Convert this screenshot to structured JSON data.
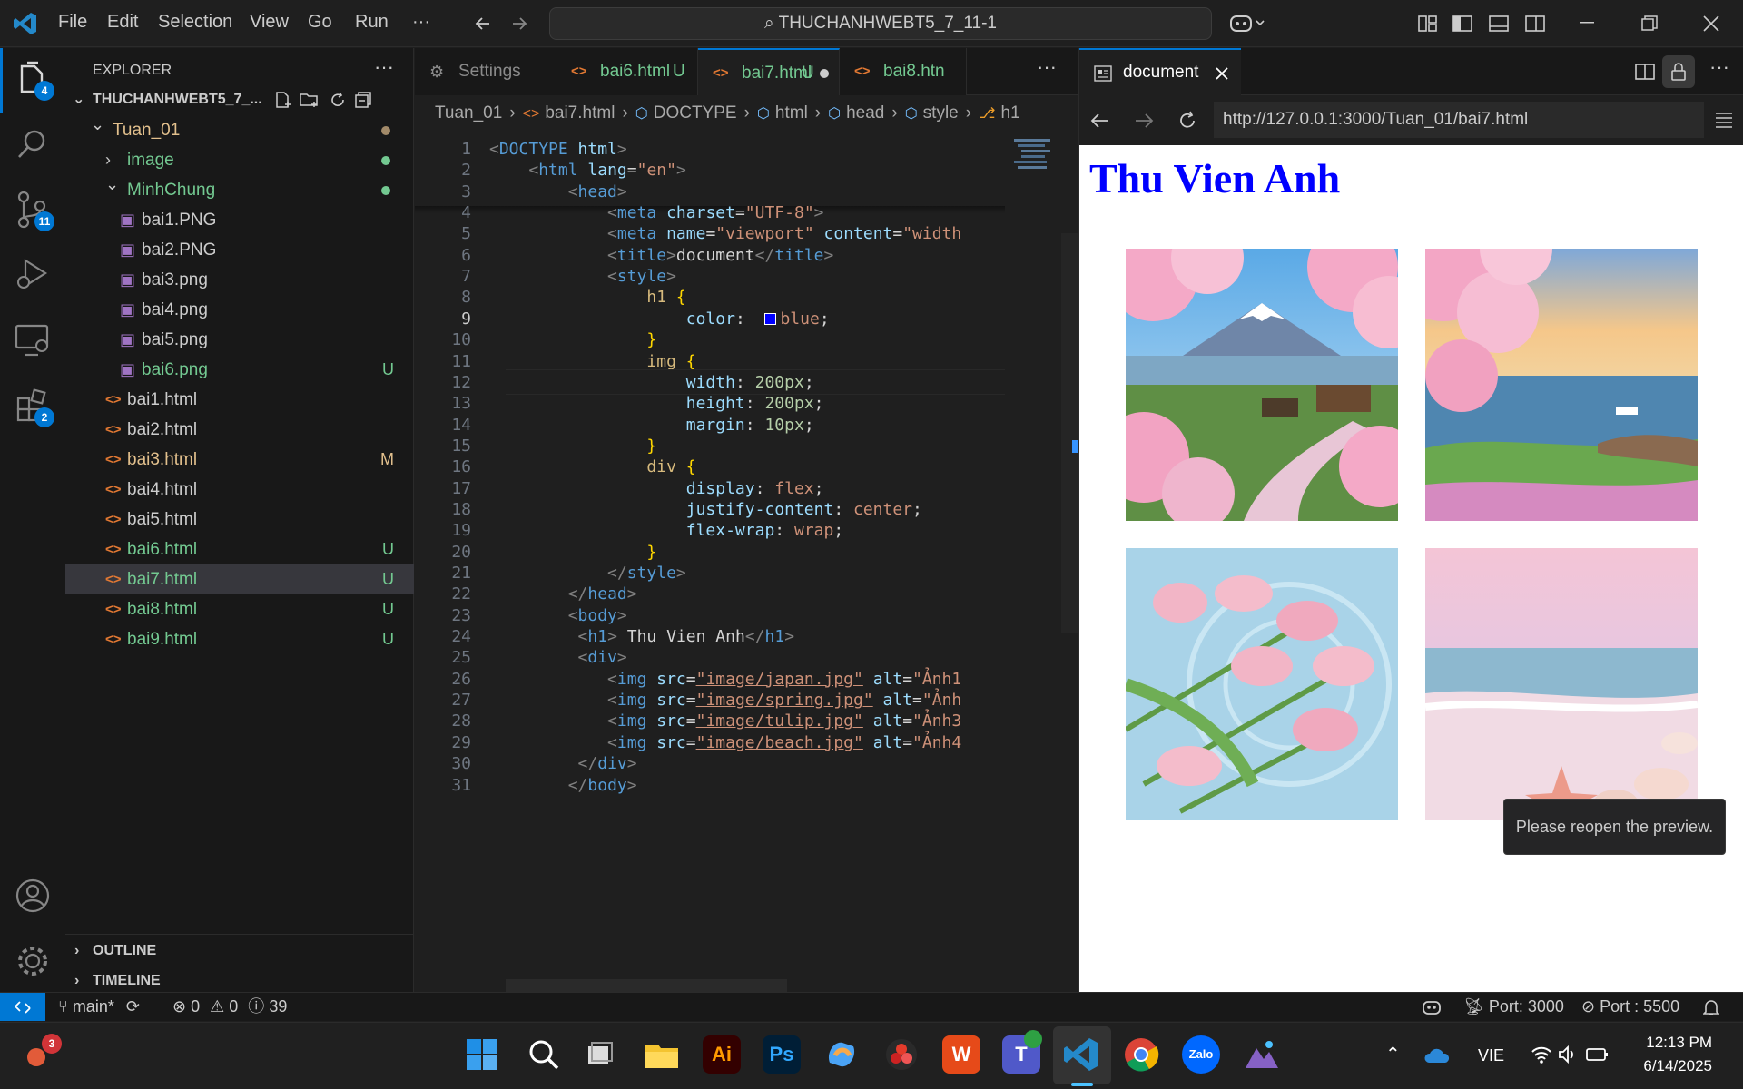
{
  "titlebar": {
    "menu": [
      "File",
      "Edit",
      "Selection",
      "View",
      "Go",
      "Run",
      "···"
    ],
    "search": "THUCHANHWEBT5_7_11-1"
  },
  "activity": {
    "explorer_badge": "4",
    "scm_badge": "11",
    "extensions_badge": "2"
  },
  "explorer": {
    "title": "EXPLORER",
    "root": "THUCHANHWEBT5_7_...",
    "items": [
      {
        "label": "Tuan_01",
        "indent": 1,
        "type": "folder-open",
        "color": "#e2c08d",
        "git": "dot",
        "gitcolor": "#a28a69"
      },
      {
        "label": "image",
        "indent": 2,
        "type": "folder",
        "color": "#73c991",
        "git": "dot",
        "gitcolor": "#73c991"
      },
      {
        "label": "MinhChung",
        "indent": 2,
        "type": "folder-open",
        "color": "#73c991",
        "git": "dot",
        "gitcolor": "#73c991"
      },
      {
        "label": "bai1.PNG",
        "indent": 3,
        "type": "image",
        "color": "#cccccc",
        "git": ""
      },
      {
        "label": "bai2.PNG",
        "indent": 3,
        "type": "image",
        "color": "#cccccc",
        "git": ""
      },
      {
        "label": "bai3.png",
        "indent": 3,
        "type": "image",
        "color": "#cccccc",
        "git": ""
      },
      {
        "label": "bai4.png",
        "indent": 3,
        "type": "image",
        "color": "#cccccc",
        "git": ""
      },
      {
        "label": "bai5.png",
        "indent": 3,
        "type": "image",
        "color": "#cccccc",
        "git": ""
      },
      {
        "label": "bai6.png",
        "indent": 3,
        "type": "image",
        "color": "#73c991",
        "git": "U",
        "gitcolor": "#73c991"
      },
      {
        "label": "bai1.html",
        "indent": 2,
        "type": "html",
        "color": "#cccccc",
        "git": ""
      },
      {
        "label": "bai2.html",
        "indent": 2,
        "type": "html",
        "color": "#cccccc",
        "git": ""
      },
      {
        "label": "bai3.html",
        "indent": 2,
        "type": "html",
        "color": "#e2c08d",
        "git": "M",
        "gitcolor": "#e2c08d"
      },
      {
        "label": "bai4.html",
        "indent": 2,
        "type": "html",
        "color": "#cccccc",
        "git": ""
      },
      {
        "label": "bai5.html",
        "indent": 2,
        "type": "html",
        "color": "#cccccc",
        "git": ""
      },
      {
        "label": "bai6.html",
        "indent": 2,
        "type": "html",
        "color": "#73c991",
        "git": "U",
        "gitcolor": "#73c991"
      },
      {
        "label": "bai7.html",
        "indent": 2,
        "type": "html",
        "color": "#73c991",
        "git": "U",
        "gitcolor": "#73c991",
        "selected": true
      },
      {
        "label": "bai8.html",
        "indent": 2,
        "type": "html",
        "color": "#73c991",
        "git": "U",
        "gitcolor": "#73c991"
      },
      {
        "label": "bai9.html",
        "indent": 2,
        "type": "html",
        "color": "#73c991",
        "git": "U",
        "gitcolor": "#73c991"
      }
    ],
    "outline": "OUTLINE",
    "timeline": "TIMELINE"
  },
  "editor": {
    "tabs": [
      {
        "label": "Settings",
        "marker": "",
        "color": "#8b8b8b"
      },
      {
        "label": "bai6.html",
        "marker": "U",
        "color": "#73c991"
      },
      {
        "label": "bai7.html",
        "marker": "U",
        "color": "#73c991",
        "active": true
      },
      {
        "label": "bai8.htn",
        "marker": "",
        "color": "#73c991"
      }
    ],
    "breadcrumb": [
      "Tuan_01",
      "bai7.html",
      "DOCTYPE",
      "html",
      "head",
      "style",
      "h1"
    ],
    "lines": [
      {
        "n": "1",
        "segs": [
          [
            "t",
            "<"
          ],
          [
            "tag",
            "DOCTYPE"
          ],
          [
            "txt",
            " "
          ],
          [
            "attr",
            "html"
          ],
          [
            "t",
            ">"
          ]
        ]
      },
      {
        "n": "2",
        "segs": [
          [
            "txt",
            "    "
          ],
          [
            "t",
            "<"
          ],
          [
            "tag",
            "html"
          ],
          [
            "txt",
            " "
          ],
          [
            "attr",
            "lang"
          ],
          [
            "txt",
            "="
          ],
          [
            "str",
            "\"en\""
          ],
          [
            "t",
            ">"
          ]
        ]
      },
      {
        "n": "3",
        "segs": [
          [
            "txt",
            "        "
          ],
          [
            "t",
            "<"
          ],
          [
            "tag",
            "head"
          ],
          [
            "t",
            ">"
          ]
        ]
      },
      {
        "n": "4",
        "segs": [
          [
            "txt",
            "            "
          ],
          [
            "t",
            "<"
          ],
          [
            "tag",
            "meta"
          ],
          [
            "txt",
            " "
          ],
          [
            "attr",
            "charset"
          ],
          [
            "txt",
            "="
          ],
          [
            "str",
            "\"UTF-8\""
          ],
          [
            "t",
            ">"
          ]
        ]
      },
      {
        "n": "5",
        "segs": [
          [
            "txt",
            "            "
          ],
          [
            "t",
            "<"
          ],
          [
            "tag",
            "meta"
          ],
          [
            "txt",
            " "
          ],
          [
            "attr",
            "name"
          ],
          [
            "txt",
            "="
          ],
          [
            "str",
            "\"viewport\""
          ],
          [
            "txt",
            " "
          ],
          [
            "attr",
            "content"
          ],
          [
            "txt",
            "="
          ],
          [
            "str",
            "\"width"
          ]
        ]
      },
      {
        "n": "6",
        "segs": [
          [
            "txt",
            "            "
          ],
          [
            "t",
            "<"
          ],
          [
            "tag",
            "title"
          ],
          [
            "t",
            ">"
          ],
          [
            "txt",
            "document"
          ],
          [
            "t",
            "</"
          ],
          [
            "tag",
            "title"
          ],
          [
            "t",
            ">"
          ]
        ]
      },
      {
        "n": "7",
        "segs": [
          [
            "txt",
            "            "
          ],
          [
            "t",
            "<"
          ],
          [
            "tag",
            "style"
          ],
          [
            "t",
            ">"
          ]
        ]
      },
      {
        "n": "8",
        "segs": [
          [
            "txt",
            "                "
          ],
          [
            "sel1",
            "h1"
          ],
          [
            "txt",
            " "
          ],
          [
            "br",
            "{"
          ]
        ]
      },
      {
        "n": "9",
        "segs": [
          [
            "txt",
            "                    "
          ],
          [
            "prop",
            "color"
          ],
          [
            "txt",
            ":  "
          ],
          [
            "val",
            "blue"
          ],
          [
            "txt",
            ";"
          ]
        ],
        "swatch": true
      },
      {
        "n": "10",
        "segs": [
          [
            "txt",
            "                "
          ],
          [
            "br",
            "}"
          ]
        ]
      },
      {
        "n": "11",
        "segs": [
          [
            "txt",
            "                "
          ],
          [
            "sel1",
            "img"
          ],
          [
            "txt",
            " "
          ],
          [
            "br",
            "{"
          ]
        ]
      },
      {
        "n": "12",
        "segs": [
          [
            "txt",
            "                    "
          ],
          [
            "prop",
            "width"
          ],
          [
            "txt",
            ": "
          ],
          [
            "num",
            "200px"
          ],
          [
            "txt",
            ";"
          ]
        ]
      },
      {
        "n": "13",
        "segs": [
          [
            "txt",
            "                    "
          ],
          [
            "prop",
            "height"
          ],
          [
            "txt",
            ": "
          ],
          [
            "num",
            "200px"
          ],
          [
            "txt",
            ";"
          ]
        ]
      },
      {
        "n": "14",
        "segs": [
          [
            "txt",
            "                    "
          ],
          [
            "prop",
            "margin"
          ],
          [
            "txt",
            ": "
          ],
          [
            "num",
            "10px"
          ],
          [
            "txt",
            ";"
          ]
        ]
      },
      {
        "n": "15",
        "segs": [
          [
            "txt",
            "                "
          ],
          [
            "br",
            "}"
          ]
        ]
      },
      {
        "n": "16",
        "segs": [
          [
            "txt",
            "                "
          ],
          [
            "sel1",
            "div"
          ],
          [
            "txt",
            " "
          ],
          [
            "br",
            "{"
          ]
        ]
      },
      {
        "n": "17",
        "segs": [
          [
            "txt",
            "                    "
          ],
          [
            "prop",
            "display"
          ],
          [
            "txt",
            ": "
          ],
          [
            "val",
            "flex"
          ],
          [
            "txt",
            ";"
          ]
        ]
      },
      {
        "n": "18",
        "segs": [
          [
            "txt",
            "                    "
          ],
          [
            "prop",
            "justify-content"
          ],
          [
            "txt",
            ": "
          ],
          [
            "val",
            "center"
          ],
          [
            "txt",
            ";"
          ]
        ]
      },
      {
        "n": "19",
        "segs": [
          [
            "txt",
            "                    "
          ],
          [
            "prop",
            "flex-wrap"
          ],
          [
            "txt",
            ": "
          ],
          [
            "val",
            "wrap"
          ],
          [
            "txt",
            ";"
          ]
        ]
      },
      {
        "n": "20",
        "segs": [
          [
            "txt",
            "                "
          ],
          [
            "br",
            "}"
          ]
        ]
      },
      {
        "n": "21",
        "segs": [
          [
            "txt",
            "            "
          ],
          [
            "t",
            "</"
          ],
          [
            "tag",
            "style"
          ],
          [
            "t",
            ">"
          ]
        ]
      },
      {
        "n": "22",
        "segs": [
          [
            "txt",
            "        "
          ],
          [
            "t",
            "</"
          ],
          [
            "tag",
            "head"
          ],
          [
            "t",
            ">"
          ]
        ]
      },
      {
        "n": "23",
        "segs": [
          [
            "txt",
            "        "
          ],
          [
            "t",
            "<"
          ],
          [
            "tag",
            "body"
          ],
          [
            "t",
            ">"
          ]
        ]
      },
      {
        "n": "24",
        "segs": [
          [
            "txt",
            "         "
          ],
          [
            "t",
            "<"
          ],
          [
            "tag",
            "h1"
          ],
          [
            "t",
            ">"
          ],
          [
            "txt",
            " Thu Vien Anh"
          ],
          [
            "t",
            "</"
          ],
          [
            "tag",
            "h1"
          ],
          [
            "t",
            ">"
          ]
        ]
      },
      {
        "n": "25",
        "segs": [
          [
            "txt",
            "         "
          ],
          [
            "t",
            "<"
          ],
          [
            "tag",
            "div"
          ],
          [
            "t",
            ">"
          ]
        ]
      },
      {
        "n": "26",
        "segs": [
          [
            "txt",
            "            "
          ],
          [
            "t",
            "<"
          ],
          [
            "tag",
            "img"
          ],
          [
            "txt",
            " "
          ],
          [
            "attr",
            "src"
          ],
          [
            "txt",
            "="
          ],
          [
            "str",
            "\"image/japan.jpg\""
          ],
          [
            "txt",
            " "
          ],
          [
            "attr",
            "alt"
          ],
          [
            "txt",
            "="
          ],
          [
            "str",
            "\"Ảnh1"
          ]
        ]
      },
      {
        "n": "27",
        "segs": [
          [
            "txt",
            "            "
          ],
          [
            "t",
            "<"
          ],
          [
            "tag",
            "img"
          ],
          [
            "txt",
            " "
          ],
          [
            "attr",
            "src"
          ],
          [
            "txt",
            "="
          ],
          [
            "str",
            "\"image/spring.jpg\""
          ],
          [
            "txt",
            " "
          ],
          [
            "attr",
            "alt"
          ],
          [
            "txt",
            "="
          ],
          [
            "str",
            "\"Ảnh"
          ]
        ]
      },
      {
        "n": "28",
        "segs": [
          [
            "txt",
            "            "
          ],
          [
            "t",
            "<"
          ],
          [
            "tag",
            "img"
          ],
          [
            "txt",
            " "
          ],
          [
            "attr",
            "src"
          ],
          [
            "txt",
            "="
          ],
          [
            "str",
            "\"image/tulip.jpg\""
          ],
          [
            "txt",
            " "
          ],
          [
            "attr",
            "alt"
          ],
          [
            "txt",
            "="
          ],
          [
            "str",
            "\"Ảnh3"
          ]
        ]
      },
      {
        "n": "29",
        "segs": [
          [
            "txt",
            "            "
          ],
          [
            "t",
            "<"
          ],
          [
            "tag",
            "img"
          ],
          [
            "txt",
            " "
          ],
          [
            "attr",
            "src"
          ],
          [
            "txt",
            "="
          ],
          [
            "str",
            "\"image/beach.jpg\""
          ],
          [
            "txt",
            " "
          ],
          [
            "attr",
            "alt"
          ],
          [
            "txt",
            "="
          ],
          [
            "str",
            "\"Ảnh4"
          ]
        ]
      },
      {
        "n": "30",
        "segs": [
          [
            "txt",
            "         "
          ],
          [
            "t",
            "</"
          ],
          [
            "tag",
            "div"
          ],
          [
            "t",
            ">"
          ]
        ]
      },
      {
        "n": "31",
        "segs": [
          [
            "txt",
            "        "
          ],
          [
            "t",
            "</"
          ],
          [
            "tag",
            "body"
          ],
          [
            "t",
            ">"
          ]
        ]
      }
    ]
  },
  "preview": {
    "tab": "document",
    "url": "http://127.0.0.1:3000/Tuan_01/bai7.html",
    "heading": "Thu Vien Anh",
    "toast": "Please reopen the preview."
  },
  "statusbar": {
    "branch": "main*",
    "errors": "0",
    "warnings": "0",
    "info": "39",
    "port1": "Port: 3000",
    "port2": "Port : 5500"
  },
  "taskbar": {
    "notif_badge": "3",
    "lang": "VIE",
    "time": "12:13 PM",
    "date": "6/14/2025"
  }
}
